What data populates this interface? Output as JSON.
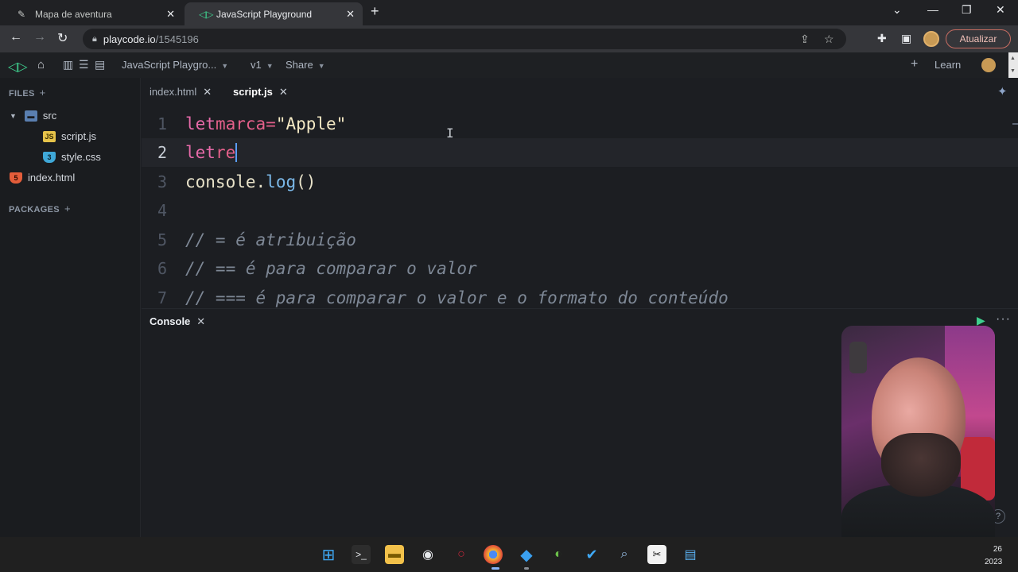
{
  "browser": {
    "tabs": [
      {
        "label": "Mapa de aventura",
        "icon": "pen-icon",
        "active": false
      },
      {
        "label": "JavaScript Playground",
        "icon": "playcode-icon",
        "active": true
      }
    ],
    "url_host": "playcode.io",
    "url_path": "/1545196",
    "update_label": "Atualizar"
  },
  "playcode": {
    "project_title": "JavaScript Playgro...",
    "version": "v1",
    "share_label": "Share",
    "learn_label": "Learn"
  },
  "sidebar": {
    "files_label": "FILES",
    "packages_label": "PACKAGES",
    "tree": [
      {
        "label": "src",
        "icon": "folder-icon",
        "type": "folder"
      },
      {
        "label": "script.js",
        "icon": "js-file-icon",
        "type": "file"
      },
      {
        "label": "style.css",
        "icon": "css-file-icon",
        "type": "file"
      },
      {
        "label": "index.html",
        "icon": "html-file-icon",
        "type": "file"
      }
    ]
  },
  "editor": {
    "tabs": [
      {
        "label": "index.html",
        "active": false
      },
      {
        "label": "script.js",
        "active": true
      }
    ],
    "line_numbers": [
      "1",
      "2",
      "3",
      "4",
      "5",
      "6",
      "7"
    ],
    "code": {
      "l1": {
        "kw": "let",
        "ident": "marca",
        "op": "=",
        "str": "\"Apple\""
      },
      "l2": {
        "kw": "let",
        "ident": "re"
      },
      "l3": {
        "obj": "console",
        "dot": ".",
        "fn": "log",
        "parens": "()"
      },
      "l5": "// = é atribuição",
      "l6": "// == é para comparar o valor",
      "l7": "// === é para comparar o valor e o formato do conteúdo"
    },
    "current_line": 2
  },
  "console": {
    "tab_label": "Console"
  },
  "taskbar": {
    "clock_day": "26",
    "clock_year": "2023"
  },
  "colors": {
    "accent_green": "#3ecf8e",
    "keyword": "#e76aa9",
    "string": "#f4e9c4",
    "function": "#7bb8e8",
    "comment": "#7e8896"
  }
}
